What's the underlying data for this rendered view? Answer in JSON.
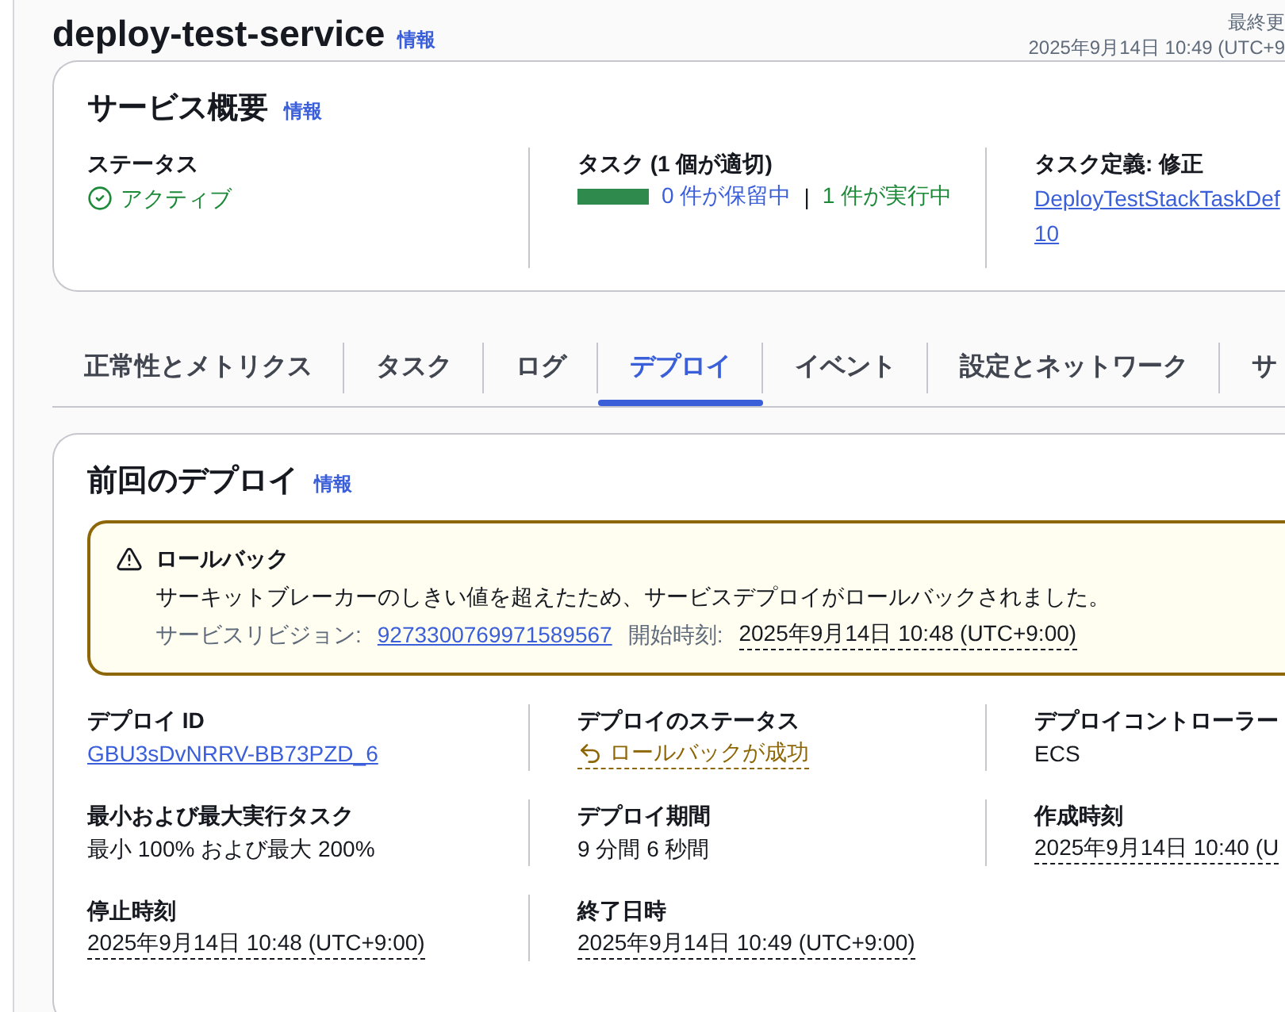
{
  "header": {
    "title": "deploy-test-service",
    "info_link": "情報",
    "last_updated_label": "最終更",
    "last_updated": "2025年9月14日 10:49 (UTC+9"
  },
  "summary": {
    "title": "サービス概要",
    "info_link": "情報",
    "status": {
      "label": "ステータス",
      "value": "アクティブ"
    },
    "tasks": {
      "label": "タスク (1 個が適切)",
      "level": 1,
      "pending": "0 件が保留中",
      "separator": "|",
      "running": "1 件が実行中"
    },
    "task_definition": {
      "label": "タスク定義: 修正",
      "link": "DeployTestStackTaskDef",
      "revision": "10"
    }
  },
  "tabs": [
    {
      "label": "正常性とメトリクス",
      "selected": false
    },
    {
      "label": "タスク",
      "selected": false
    },
    {
      "label": "ログ",
      "selected": false
    },
    {
      "label": "デプロイ",
      "selected": true
    },
    {
      "label": "イベント",
      "selected": false
    },
    {
      "label": "設定とネットワーク",
      "selected": false
    },
    {
      "label": "サ",
      "selected": false
    }
  ],
  "deployment": {
    "title": "前回のデプロイ",
    "info_link": "情報",
    "alert": {
      "title": "ロールバック",
      "message": "サーキットブレーカーのしきい値を超えたため、サービスデプロイがロールバックされました。",
      "revision_label": "サービスリビジョン:",
      "revision": "9273300769971589567",
      "start_label": "開始時刻:",
      "start_time": "2025年9月14日 10:48 (UTC+9:00)"
    },
    "fields": [
      {
        "label": "デプロイ ID",
        "value": "GBU3sDvNRRV-BB73PZD_6",
        "kind": "link"
      },
      {
        "label": "デプロイのステータス",
        "value": "ロールバックが成功",
        "kind": "status"
      },
      {
        "label": "デプロイコントローラー",
        "value": "ECS",
        "kind": "text"
      },
      {
        "label": "最小および最大実行タスク",
        "value": "最小 100% および最大 200%",
        "kind": "text"
      },
      {
        "label": "デプロイ期間",
        "value": "9 分間 6 秒間",
        "kind": "text"
      },
      {
        "label": "作成時刻",
        "value": "2025年9月14日 10:40 (U",
        "kind": "time"
      },
      {
        "label": "停止時刻",
        "value": "2025年9月14日 10:48 (UTC+9:00)",
        "kind": "time"
      },
      {
        "label": "終了日時",
        "value": "2025年9月14日 10:49 (UTC+9:00)",
        "kind": "time"
      }
    ]
  }
}
